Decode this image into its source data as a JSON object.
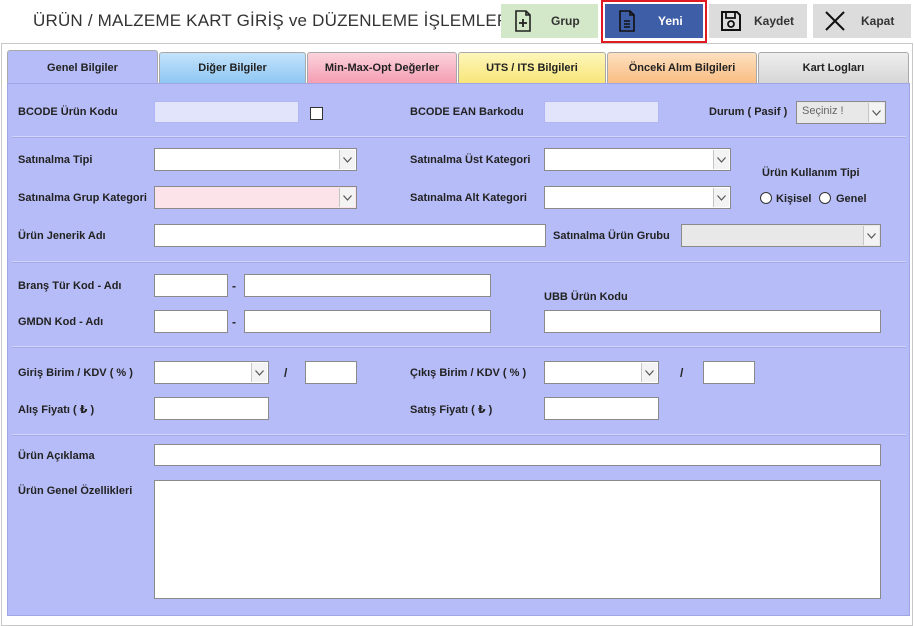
{
  "header": {
    "title": "ÜRÜN / MALZEME KART GİRİŞ ve DÜZENLEME İŞLEMLERİ"
  },
  "toolbar": {
    "grup_label": "Grup",
    "yeni_label": "Yeni",
    "kaydet_label": "Kaydet",
    "kapat_label": "Kapat"
  },
  "tabs": [
    {
      "label": "Genel Bilgiler",
      "color": "#b6bcf7"
    },
    {
      "label": "Diğer Bilgiler",
      "color": "#8fc7f3"
    },
    {
      "label": "Min-Max-Opt Değerler",
      "color": "#f59db3"
    },
    {
      "label": "UTS / ITS Bilgileri",
      "color": "#f8e67a"
    },
    {
      "label": "Önceki Alım Bilgileri",
      "color": "#f9bd82"
    },
    {
      "label": "Kart Logları",
      "color": "#d6d6d6"
    }
  ],
  "form": {
    "bcode_urun_kodu": {
      "label": "BCODE Ürün Kodu",
      "value": ""
    },
    "bcode_ean_barkodu": {
      "label": "BCODE EAN Barkodu",
      "value": ""
    },
    "durum": {
      "label": "Durum ( Pasif )",
      "value": "Seçiniz !"
    },
    "satinalma_tipi": {
      "label": "Satınalma Tipi",
      "value": ""
    },
    "satinalma_ust_kategori": {
      "label": "Satınalma Üst Kategori",
      "value": ""
    },
    "urun_kullanim_tipi": {
      "label": "Ürün Kullanım Tipi",
      "options": [
        "Kişisel",
        "Genel"
      ]
    },
    "satinalma_grup_kategori": {
      "label": "Satınalma Grup Kategori",
      "value": ""
    },
    "satinalma_alt_kategori": {
      "label": "Satınalma Alt Kategori",
      "value": ""
    },
    "urun_jenerik_adi": {
      "label": "Ürün Jenerik Adı",
      "value": ""
    },
    "satinalma_urun_grubu": {
      "label": "Satınalma Ürün Grubu",
      "value": ""
    },
    "brans_tur_kod": {
      "label": "Branş Tür Kod - Adı",
      "code": "",
      "name": ""
    },
    "ubb_urun_kodu": {
      "label": "UBB Ürün Kodu",
      "value": ""
    },
    "gmdn_kod": {
      "label": "GMDN Kod - Adı",
      "code": "",
      "name": ""
    },
    "giris_birim": {
      "label": "Giriş Birim / KDV ( % )",
      "unit": "",
      "kdv": ""
    },
    "cikis_birim": {
      "label": "Çıkış Birim / KDV ( % )",
      "unit": "",
      "kdv": ""
    },
    "alis_fiyati": {
      "label": "Alış Fiyatı  ( ₺ )",
      "value": ""
    },
    "satis_fiyati": {
      "label": "Satış Fiyatı  ( ₺ )",
      "value": ""
    },
    "urun_aciklama": {
      "label": "Ürün Açıklama",
      "value": ""
    },
    "urun_genel_ozellikleri": {
      "label": "Ürün Genel Özellikleri",
      "value": ""
    },
    "slash": "/",
    "dash": "-"
  },
  "colors": {
    "panel_bg": "#b6bcf7",
    "accent_button": "#3f5ea8",
    "highlight_border": "#e01a22",
    "grup_button": "#d3e8c8"
  }
}
